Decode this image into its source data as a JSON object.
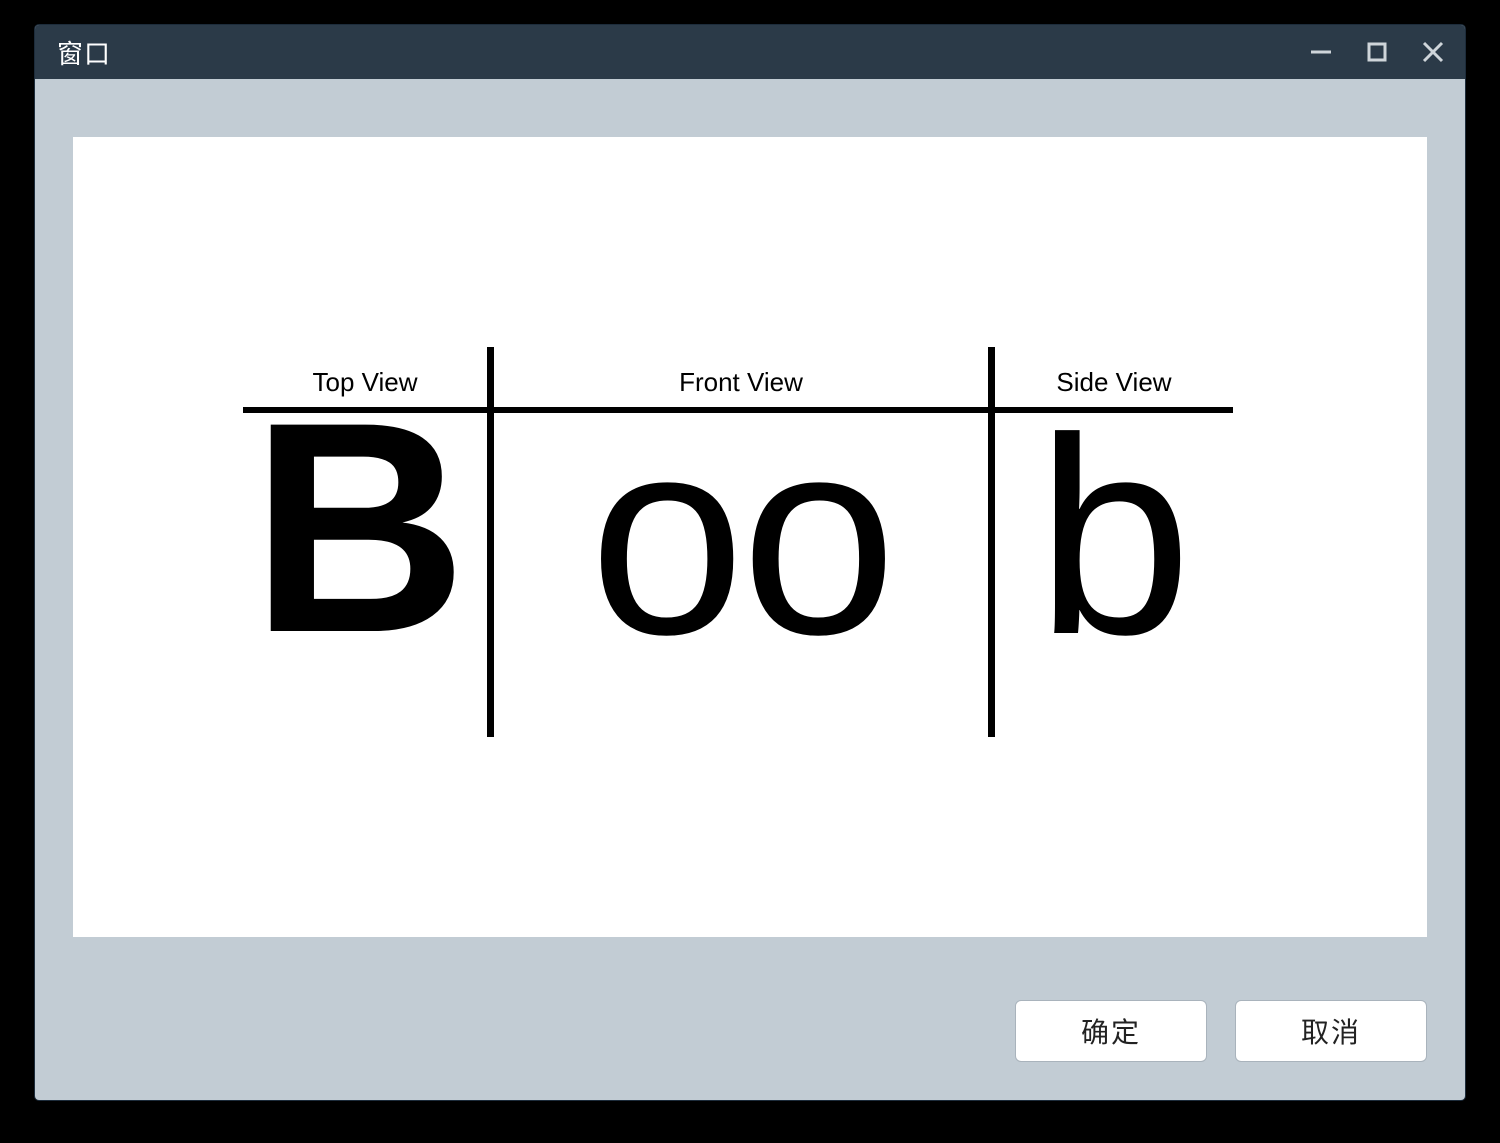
{
  "window": {
    "title": "窗口"
  },
  "diagram": {
    "segments": [
      {
        "label": "Top View",
        "glyph": "B"
      },
      {
        "label": "Front View",
        "glyph": "oo"
      },
      {
        "label": "Side View",
        "glyph": "b"
      }
    ]
  },
  "buttons": {
    "ok": "确定",
    "cancel": "取消"
  }
}
